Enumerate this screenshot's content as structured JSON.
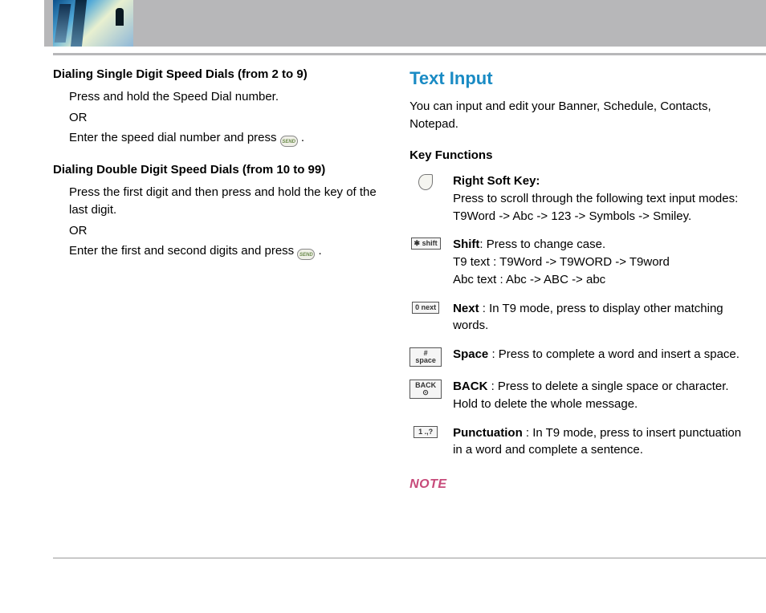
{
  "left": {
    "h1": "Dialing Single Digit Speed Dials (from 2 to 9)",
    "l1": "Press and hold the Speed Dial number.",
    "l2": "OR",
    "l3a": "Enter the speed dial number and press ",
    "l3b": " .",
    "h2": "Dialing Double Digit Speed Dials (from 10 to 99)",
    "l4": "Press the first digit and then press and hold the key of the last digit.",
    "l5": "OR",
    "l6a": "Enter the first and second digits and press ",
    "l6b": " ."
  },
  "send_label": "SEND",
  "right": {
    "title": "Text Input",
    "intro": "You can input and edit your Banner, Schedule, Contacts, Notepad.",
    "kf_title": "Key Functions",
    "rows": [
      {
        "icon": "softkey",
        "name": "Right Soft Key:",
        "suffix": "",
        "desc": "Press to scroll through the following text input modes: T9Word -> Abc -> 123 -> Symbols -> Smiley."
      },
      {
        "icon": "star",
        "name": "Shift",
        "suffix": ": Press to change case.",
        "desc": "T9 text : T9Word -> T9WORD -> T9word\nAbc text : Abc -> ABC -> abc"
      },
      {
        "icon": "zero",
        "name": "Next ",
        "suffix": ": In T9 mode, press to display other matching words.",
        "desc": ""
      },
      {
        "icon": "hash",
        "name": "Space ",
        "suffix": ": Press to complete a word and insert a space.",
        "desc": ""
      },
      {
        "icon": "back",
        "name": "BACK ",
        "suffix": ": Press to delete a single space or character. Hold to delete the whole message.",
        "desc": ""
      },
      {
        "icon": "one",
        "name": "Punctuation ",
        "suffix": ": In T9 mode, press to insert punctuation in a word and complete a sentence.",
        "desc": ""
      }
    ],
    "note": "NOTE"
  },
  "icon_labels": {
    "star": "✱ shift",
    "zero": "0 next",
    "hash": "# space",
    "back": "BACK ⊙",
    "one": "1 .,?"
  }
}
